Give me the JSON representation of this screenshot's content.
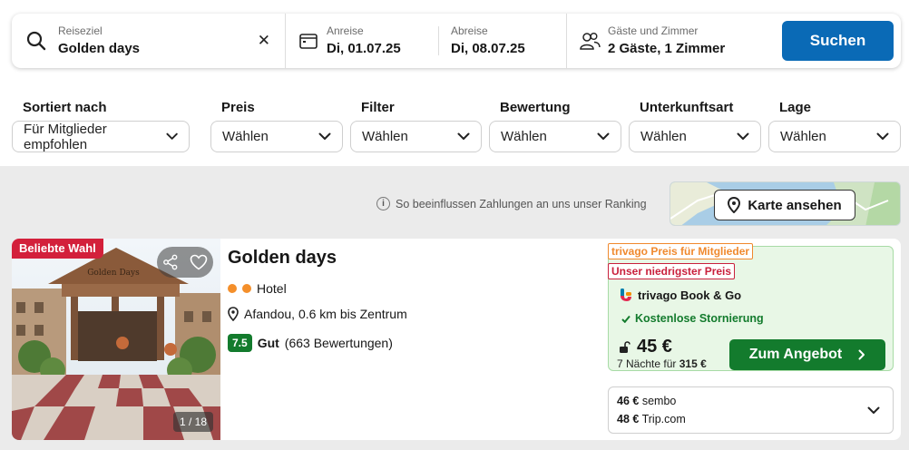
{
  "search": {
    "destination_label": "Reiseziel",
    "destination_value": "Golden days",
    "clear_symbol": "✕",
    "checkin_label": "Anreise",
    "checkin_value": "Di, 01.07.25",
    "checkout_label": "Abreise",
    "checkout_value": "Di, 08.07.25",
    "guests_label": "Gäste und Zimmer",
    "guests_value": "2 Gäste, 1 Zimmer",
    "submit_label": "Suchen"
  },
  "filters": [
    {
      "label": "Sortiert nach",
      "value": "Für Mitglieder empfohlen"
    },
    {
      "label": "Preis",
      "value": "Wählen"
    },
    {
      "label": "Filter",
      "value": "Wählen"
    },
    {
      "label": "Bewertung",
      "value": "Wählen"
    },
    {
      "label": "Unterkunftsart",
      "value": "Wählen"
    },
    {
      "label": "Lage",
      "value": "Wählen"
    }
  ],
  "ranking_note": "So beeinflussen Zahlungen an uns unser Ranking",
  "info_symbol": "i",
  "map_button_label": "Karte ansehen",
  "result": {
    "badge": "Beliebte Wahl",
    "photo_counter": "1 / 18",
    "photo_sign": "Golden Days",
    "name": "Golden days",
    "type": "Hotel",
    "stars": 2,
    "location": "Afandou, 0.6 km bis Zentrum",
    "rating_score": "7.5",
    "rating_word": "Gut",
    "rating_count": "(663 Bewertungen)",
    "tag_member": "trivago Preis für Mitglieder",
    "tag_lowest": "Unser niedrigster Preis",
    "provider": "trivago Book & Go",
    "cancellation": "Kostenlose Stornierung",
    "price": "45 €",
    "nights_text": "7 Nächte für",
    "nights_total": "315 €",
    "deal_button": "Zum Angebot",
    "other_offers": [
      {
        "price": "46 €",
        "site": "sembo"
      },
      {
        "price": "48 €",
        "site": "Trip.com"
      }
    ]
  },
  "colors": {
    "brand_blue": "#0a6ab6",
    "deal_green": "#137b2d",
    "popular_red": "#d3203b",
    "member_orange": "#f0892e"
  },
  "icons": [
    "search-icon",
    "close-icon",
    "calendar-icon",
    "guests-icon",
    "chevron-down-icon",
    "info-icon",
    "map-pin-icon",
    "share-icon",
    "heart-icon",
    "lock-icon",
    "checkmark-icon",
    "chevron-right-icon",
    "trivago-logo-icon"
  ]
}
